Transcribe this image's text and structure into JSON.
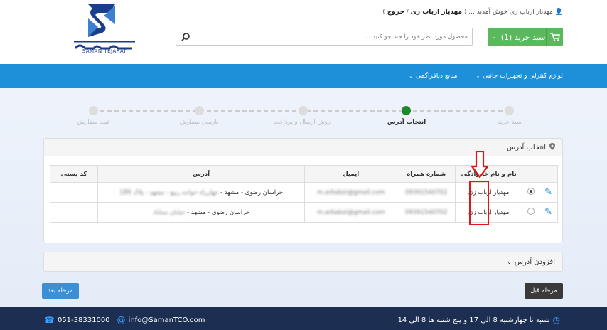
{
  "brand": {
    "logo_text": "سامانه تجارت",
    "logo_sub": "SAMAN TEJARAT"
  },
  "user": {
    "welcome_name": "مهدیار ارباب زی",
    "welcome_text": "خوش آمدید ...",
    "bold_name": "مهدیار ارباب زی",
    "logout": "خروج"
  },
  "search": {
    "placeholder": "محصول مورد نظر خود را جستجو کنید ..."
  },
  "cart": {
    "label": "سبد خرید (1)"
  },
  "nav": {
    "items": [
      {
        "label": "لوازم کنترلی و تجهیزات جانبی"
      },
      {
        "label": "منابع دیافراگمی"
      }
    ]
  },
  "steps": [
    {
      "label": "سبد خرید",
      "state": "done"
    },
    {
      "label": "انتخاب آدرس",
      "state": "active"
    },
    {
      "label": "روش ارسال و پرداخت",
      "state": "pending"
    },
    {
      "label": "بازبینی سفارش",
      "state": "pending"
    },
    {
      "label": "ثبت سفارش",
      "state": "pending"
    }
  ],
  "address_panel": {
    "title": "انتخاب آدرس",
    "headers": [
      "",
      "",
      "نام و نام خانوادگی",
      "شماره همراه",
      "ایمیل",
      "آدرس",
      "کد پستی"
    ],
    "rows": [
      {
        "name": "مهدیار ارباب زی",
        "mobile": "09391540702",
        "email": "m.arbabzi@gmail.com",
        "address_visible": "خراسان رضوی - مشهد - ",
        "address_blurred": "چهارراه خواجه ربیع - مشهد - پلاک 189",
        "postal": "",
        "selected": true
      },
      {
        "name": "مهدیار ارباب زی",
        "mobile": "09391540702",
        "email": "m.arbabzi@gmail.com",
        "address_visible": "خراسان رضوی - مشهد - ",
        "address_blurred": "خیابان سناباد",
        "postal": "",
        "selected": false
      }
    ]
  },
  "add_address": {
    "label": "افزودن آدرس"
  },
  "buttons": {
    "next": "مرحله بعد",
    "prev": "مرحله قبل"
  },
  "footer": {
    "hours": "شنبه تا چهارشنبه 8 الی 17 و پنج شنبه ها 8 الی 14",
    "email": "info@SamanTCO.com",
    "phone": "051-38331000"
  },
  "colors": {
    "nav_blue": "#1e8fd9",
    "cart_green": "#5cb85c",
    "step_active": "#1d8a2a",
    "footer_bg": "#1c2f53",
    "highlight_red": "#e01515"
  }
}
